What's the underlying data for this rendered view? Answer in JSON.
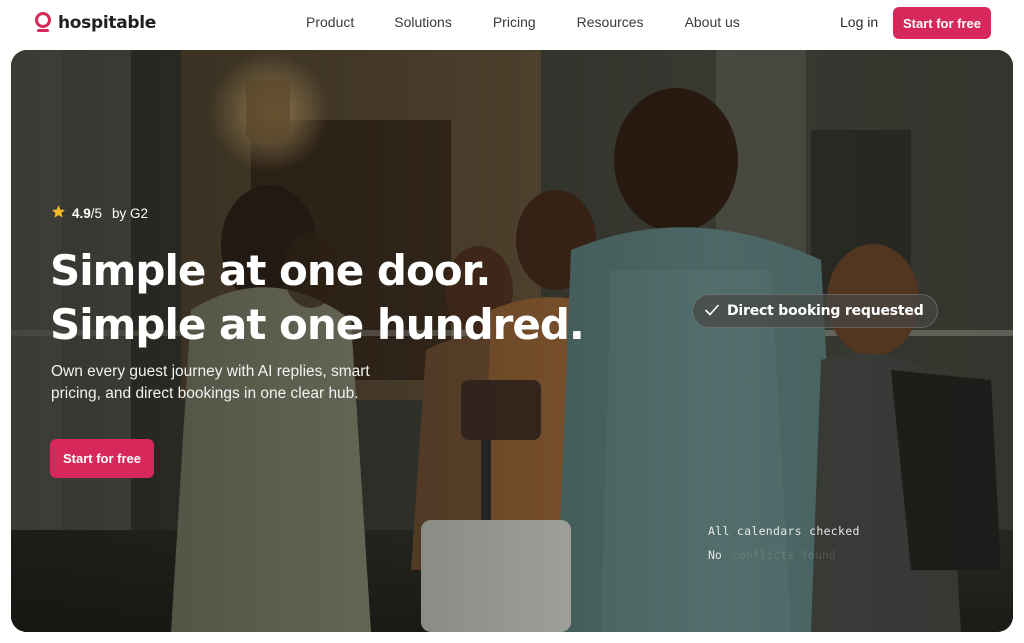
{
  "brand": {
    "name": "hospitable",
    "accent": "#d6285a"
  },
  "nav": {
    "links": [
      "Product",
      "Solutions",
      "Pricing",
      "Resources",
      "About us"
    ],
    "login": "Log in",
    "cta": "Start for free"
  },
  "hero": {
    "rating": {
      "score": "4.9",
      "out_of": "/5",
      "source": "by G2",
      "icon": "star-icon"
    },
    "headline_line1": "Simple at one door.",
    "headline_line2": "Simple at one hundred.",
    "subtext": "Own every guest journey with AI replies, smart pricing, and direct bookings in one clear hub.",
    "cta": "Start for free",
    "status_pill": {
      "icon": "check-icon",
      "text": "Direct booking requested"
    },
    "log_line1": "All calendars checked",
    "log_line2_prefix": "No",
    "log_line2_faded": "conflicts found"
  }
}
